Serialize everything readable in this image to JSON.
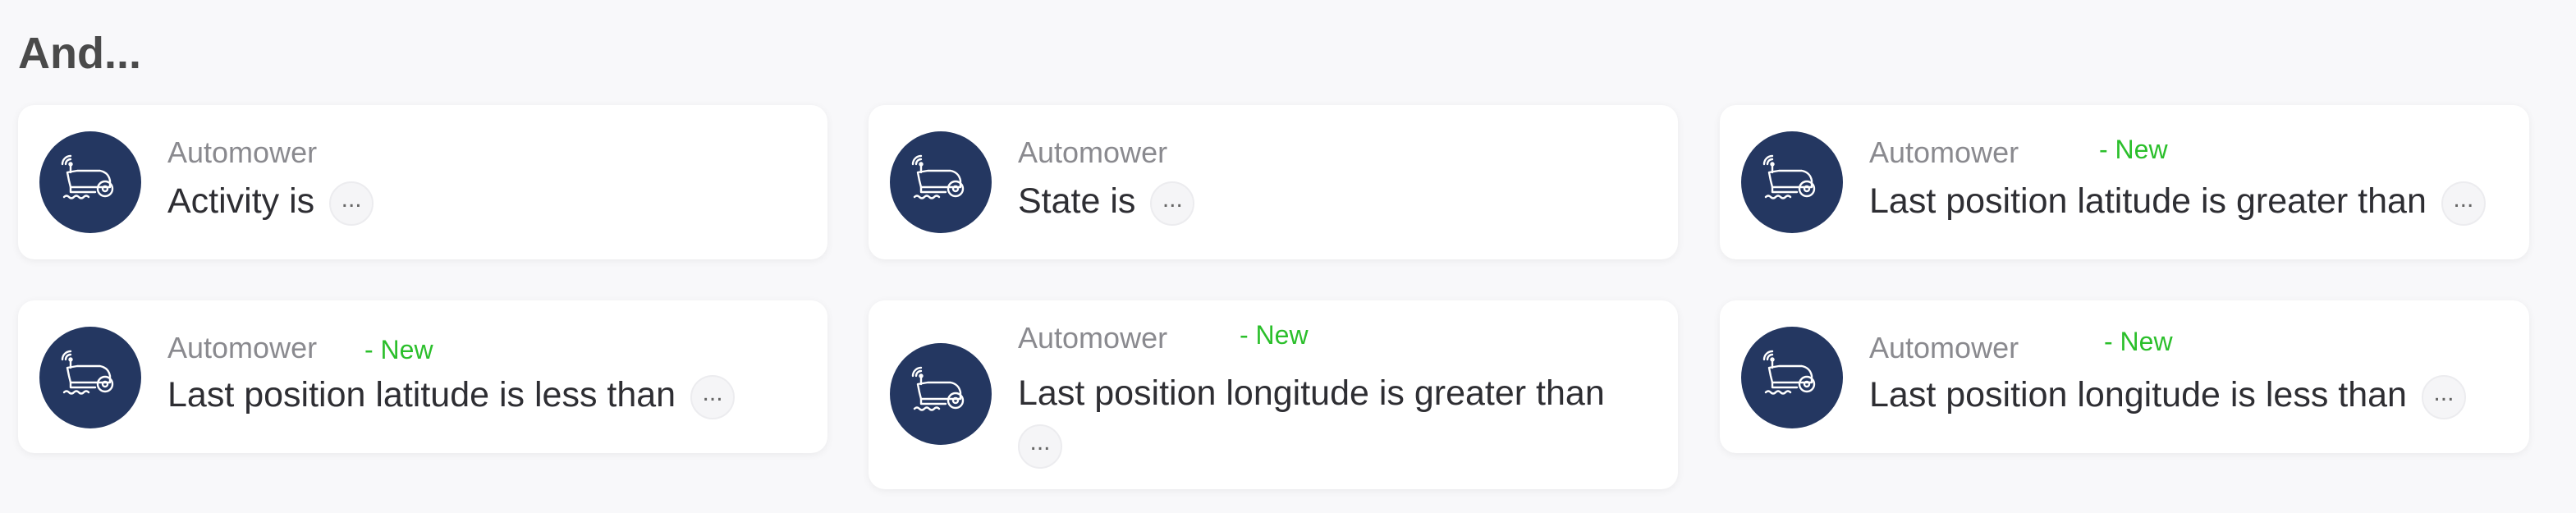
{
  "section": {
    "title": "And..."
  },
  "cards": [
    {
      "app": "Automower",
      "condition": "Activity is",
      "arg": "...",
      "new_label": ""
    },
    {
      "app": "Automower",
      "condition": "State is",
      "arg": "...",
      "new_label": ""
    },
    {
      "app": "Automower",
      "condition": "Last position latitude is greater than",
      "arg": "...",
      "new_label": "- New"
    },
    {
      "app": "Automower",
      "condition": "Last position latitude is less than",
      "arg": "...",
      "new_label": "- New"
    },
    {
      "app": "Automower",
      "condition": "Last position longitude is greater than",
      "arg": "...",
      "new_label": "- New"
    },
    {
      "app": "Automower",
      "condition": "Last position longitude is less than",
      "arg": "...",
      "new_label": "- New"
    }
  ],
  "colors": {
    "avatar_bg": "#243761",
    "new_badge": "#2bbf2b",
    "background": "#f8f8fa"
  },
  "icons": {
    "card_icon": "robotic-mower-icon"
  }
}
